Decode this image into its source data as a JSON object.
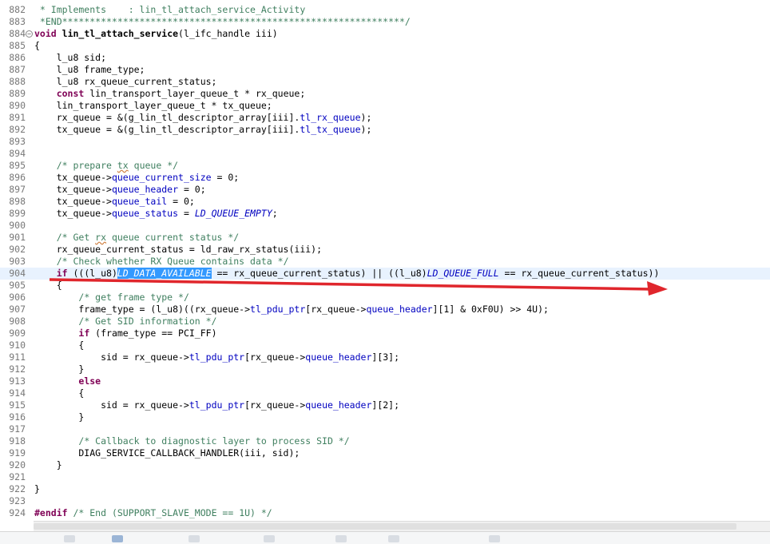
{
  "editor": {
    "lines": [
      {
        "n": "882",
        "html": "<span class=\"cm\"> * Implements    : lin_tl_attach_service_Activity</span>"
      },
      {
        "n": "883",
        "html": "<span class=\"cm\"> *END**************************************************************/</span>"
      },
      {
        "n": "884",
        "fold": true,
        "html": "<span class=\"kw\">void</span> <b>lin_tl_attach_service</b>(l_ifc_handle iii)"
      },
      {
        "n": "885",
        "html": "{"
      },
      {
        "n": "886",
        "html": "    l_u8 sid;"
      },
      {
        "n": "887",
        "html": "    l_u8 frame_type;"
      },
      {
        "n": "888",
        "html": "    l_u8 rx_queue_current_status;"
      },
      {
        "n": "889",
        "html": "    <span class=\"kw\">const</span> lin_transport_layer_queue_t * rx_queue;"
      },
      {
        "n": "890",
        "html": "    lin_transport_layer_queue_t * tx_queue;"
      },
      {
        "n": "891",
        "html": "    rx_queue = &amp;(g_lin_tl_descriptor_array[iii].<span class=\"fld\">tl_rx_queue</span>);"
      },
      {
        "n": "892",
        "html": "    tx_queue = &amp;(g_lin_tl_descriptor_array[iii].<span class=\"fld\">tl_tx_queue</span>);"
      },
      {
        "n": "893",
        "html": ""
      },
      {
        "n": "894",
        "html": ""
      },
      {
        "n": "895",
        "html": "    <span class=\"cm\">/* prepare <span class=\"sq\">tx</span> queue */</span>"
      },
      {
        "n": "896",
        "html": "    tx_queue-&gt;<span class=\"fld\">queue_current_size</span> = 0;"
      },
      {
        "n": "897",
        "html": "    tx_queue-&gt;<span class=\"fld\">queue_header</span> = 0;"
      },
      {
        "n": "898",
        "html": "    tx_queue-&gt;<span class=\"fld\">queue_tail</span> = 0;"
      },
      {
        "n": "899",
        "html": "    tx_queue-&gt;<span class=\"fld\">queue_status</span> = <span class=\"mac\">LD_QUEUE_EMPTY</span>;"
      },
      {
        "n": "900",
        "html": ""
      },
      {
        "n": "901",
        "html": "    <span class=\"cm\">/* Get <span class=\"sq\">rx</span> queue current status */</span>"
      },
      {
        "n": "902",
        "html": "    rx_queue_current_status = ld_raw_rx_status(iii);"
      },
      {
        "n": "903",
        "html": "    <span class=\"cm\">/* Check whether RX Queue contains data */</span>"
      },
      {
        "n": "904",
        "current": true,
        "html": "    <span class=\"kw\">if</span> (((l_u8)<span class=\"sel\">LD_DATA_AVAILABLE</span> == rx_queue_current_status) || ((l_u8)<span class=\"mac\">LD_QUEUE_FULL</span> == rx_queue_current_status))"
      },
      {
        "n": "905",
        "html": "    {"
      },
      {
        "n": "906",
        "html": "        <span class=\"cm\">/* get frame type */</span>"
      },
      {
        "n": "907",
        "html": "        frame_type = (l_u8)((rx_queue-&gt;<span class=\"fld\">tl_pdu_ptr</span>[rx_queue-&gt;<span class=\"fld\">queue_header</span>][1] &amp; 0xF0U) &gt;&gt; 4U);"
      },
      {
        "n": "908",
        "html": "        <span class=\"cm\">/* Get SID information */</span>"
      },
      {
        "n": "909",
        "html": "        <span class=\"kw\">if</span> (frame_type == PCI_FF)"
      },
      {
        "n": "910",
        "html": "        {"
      },
      {
        "n": "911",
        "html": "            sid = rx_queue-&gt;<span class=\"fld\">tl_pdu_ptr</span>[rx_queue-&gt;<span class=\"fld\">queue_header</span>][3];"
      },
      {
        "n": "912",
        "html": "        }"
      },
      {
        "n": "913",
        "html": "        <span class=\"kw\">else</span>"
      },
      {
        "n": "914",
        "html": "        {"
      },
      {
        "n": "915",
        "html": "            sid = rx_queue-&gt;<span class=\"fld\">tl_pdu_ptr</span>[rx_queue-&gt;<span class=\"fld\">queue_header</span>][2];"
      },
      {
        "n": "916",
        "html": "        }"
      },
      {
        "n": "917",
        "html": ""
      },
      {
        "n": "918",
        "html": "        <span class=\"cm\">/* Callback to diagnostic layer to process SID */</span>"
      },
      {
        "n": "919",
        "html": "        DIAG_SERVICE_CALLBACK_HANDLER(iii, sid);"
      },
      {
        "n": "920",
        "html": "    }"
      },
      {
        "n": "921",
        "html": ""
      },
      {
        "n": "922",
        "html": "}"
      },
      {
        "n": "923",
        "html": ""
      },
      {
        "n": "924",
        "html": "<span class=\"kw\">#endif</span> <span class=\"cm\">/* End (SUPPORT_SLAVE_MODE == 1U) */</span>"
      }
    ]
  },
  "annotation": {
    "color": "#e0262c"
  },
  "colors": {
    "keyword": "#7f0055",
    "comment": "#3f7f5f",
    "field": "#0000c0",
    "selection": "#3399ff",
    "current_line": "#e8f2fe"
  }
}
